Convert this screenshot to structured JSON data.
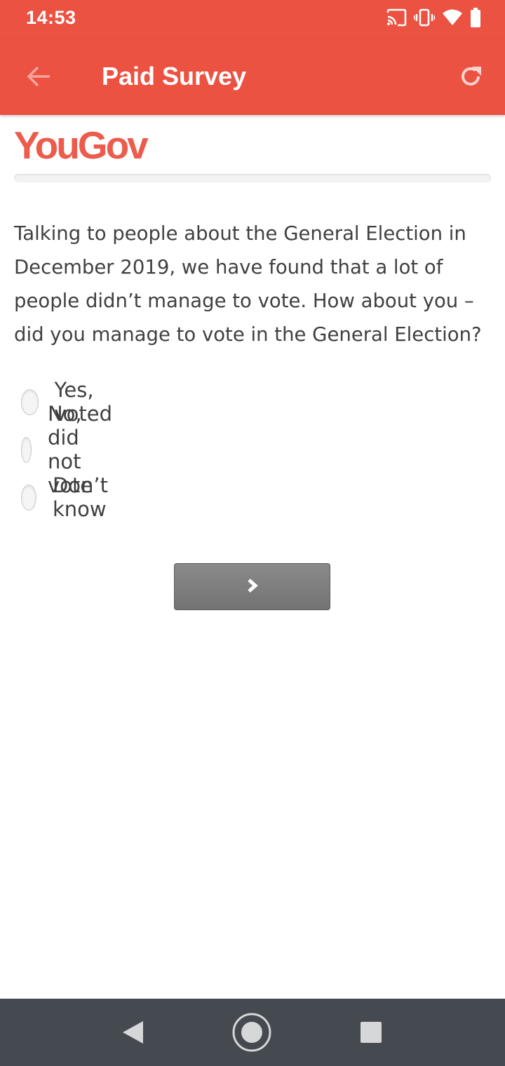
{
  "status_bar": {
    "time": "14:53",
    "icons": [
      "cast-icon",
      "vibrate-icon",
      "wifi-icon",
      "battery-icon"
    ]
  },
  "app_bar": {
    "title": "Paid Survey",
    "back_icon": "arrow-back-icon",
    "refresh_icon": "refresh-icon",
    "background_color": "#EB5242"
  },
  "survey": {
    "logo_text": "YouGov",
    "logo_color": "#ED5B4C",
    "progress": 0,
    "question": "Talking to people about the General Election in December 2019, we have found that a lot of people didn’t manage to vote. How about you – did you manage to vote in the General Election?",
    "options": [
      {
        "label": "Yes, voted",
        "selected": false
      },
      {
        "label": "No, did not vote",
        "selected": false
      },
      {
        "label": "Don’t know",
        "selected": false
      }
    ],
    "next_icon": "chevron-right-icon"
  },
  "nav_bar": {
    "icons": [
      "nav-back-icon",
      "nav-home-icon",
      "nav-recents-icon"
    ]
  }
}
